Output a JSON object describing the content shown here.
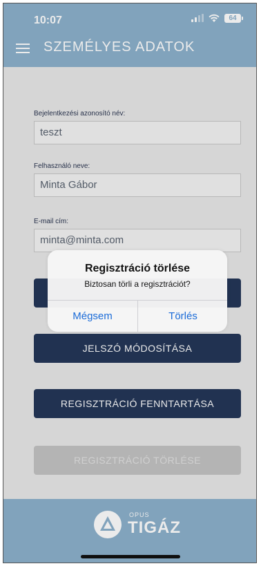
{
  "status_bar": {
    "time": "10:07",
    "battery": "64"
  },
  "header": {
    "title": "SZEMÉLYES ADATOK"
  },
  "form": {
    "login_label": "Bejelentkezési azonosító név:",
    "login_value": "teszt",
    "name_label": "Felhasználó neve:",
    "name_value": "Minta Gábor",
    "email_label": "E-mail cím:",
    "email_value": "minta@minta.com"
  },
  "buttons": {
    "password_change": "JELSZÓ MÓDOSÍTÁSA",
    "keep_registration": "REGISZTRÁCIÓ FENNTARTÁSA",
    "delete_registration": "REGISZTRÁCIÓ TÖRLÉSE"
  },
  "dialog": {
    "title": "Regisztráció törlése",
    "message": "Biztosan törli a regisztrációt?",
    "cancel_label": "Mégsem",
    "confirm_label": "Törlés"
  },
  "footer": {
    "logo_top": "OPUS",
    "logo_main": "TIGÁZ"
  },
  "colors": {
    "header_bg": "#8db1cc",
    "button_bg": "#243758",
    "disabled_bg": "#c4c4c4",
    "link_blue": "#1a6bd8"
  },
  "icons": [
    "signal-icon",
    "wifi-icon",
    "battery-icon",
    "menu-icon",
    "tigaz-logo-icon"
  ]
}
